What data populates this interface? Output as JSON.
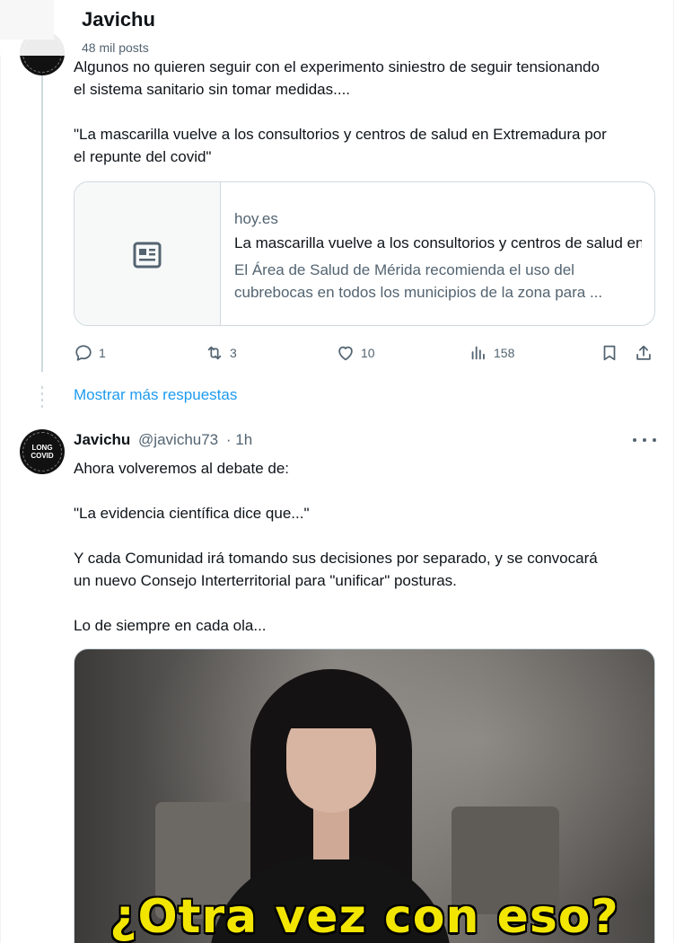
{
  "header": {
    "title": "Javichu",
    "subtitle": "48 mil posts"
  },
  "tweet1": {
    "text": "Algunos no quieren seguir con el experimento siniestro de seguir tensionando\nel sistema sanitario sin tomar medidas....\n\n\"La mascarilla vuelve a los consultorios y centros de salud en Extremadura por\nel repunte del covid\"",
    "card": {
      "domain": "hoy.es",
      "title": "La mascarilla vuelve a los consultorios y centros de salud en Extremadura por el repunte del covid",
      "description": "El Área de Salud de Mérida recomienda el uso del cubrebocas en todos los municipios de la zona para ...",
      "icon": "article-icon"
    },
    "actions": {
      "replies": "1",
      "reposts": "3",
      "likes": "10",
      "views": "158"
    }
  },
  "show_more": "Mostrar más respuestas",
  "tweet2": {
    "name": "Javichu",
    "handle": "@javichu73",
    "time": "· 1h",
    "avatar_text": "LONG COVID",
    "text": "Ahora volveremos al debate de:\n\n\"La evidencia científica dice que...\"\n\nY cada Comunidad irá tomando sus decisiones por separado, y se convocará\nun nuevo Consejo Interterritorial para \"unificar\" posturas.\n\nLo de siempre en cada ola...",
    "media_caption": "¿Otra vez con eso?"
  },
  "colors": {
    "accent": "#1d9bf0",
    "secondary_text": "#536471",
    "caption_yellow": "#f2e600"
  }
}
